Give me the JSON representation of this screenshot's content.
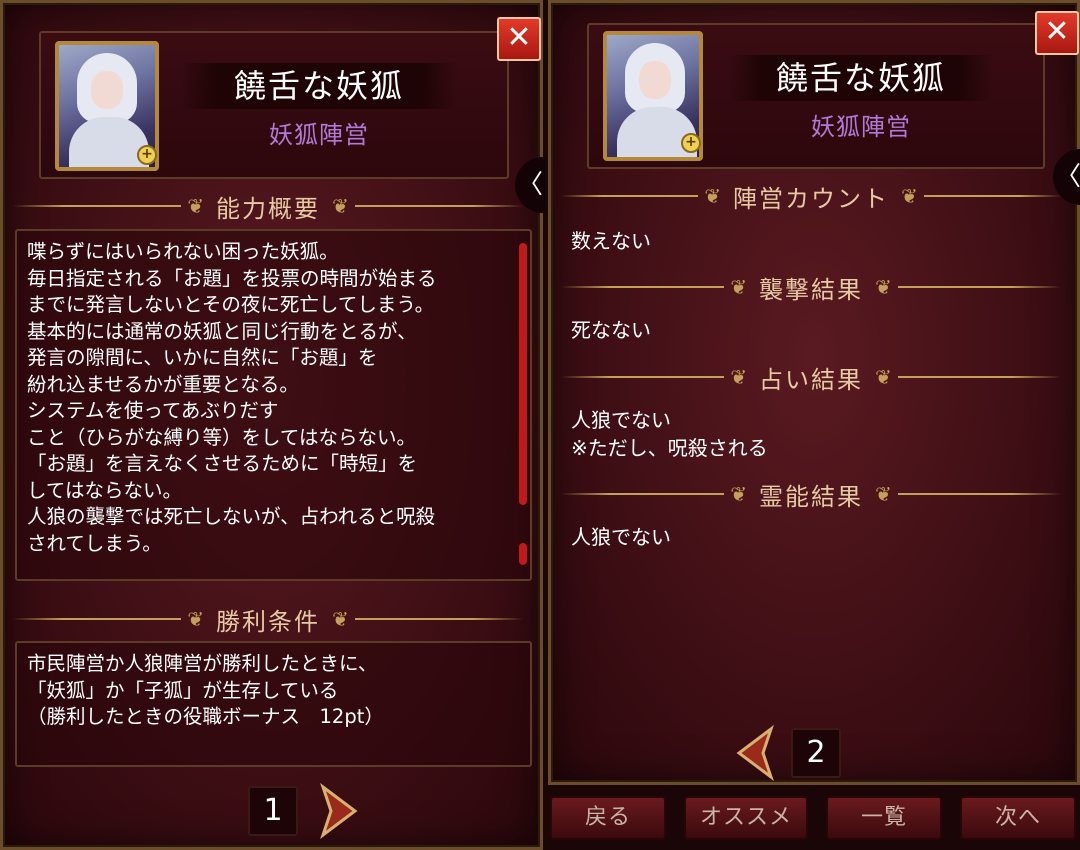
{
  "left_panel": {
    "name": "饒舌な妖狐",
    "faction": "妖狐陣営",
    "close_label": "✕",
    "side_arrow": "〈",
    "ability_header": "能力概要",
    "ability_lines": [
      "喋らずにはいられない困った妖狐。",
      "毎日指定される「お題」を投票の時間が始まる",
      "までに発言しないとその夜に死亡してしまう。",
      "基本的には通常の妖狐と同じ行動をとるが、",
      "発言の隙間に、いかに自然に「お題」を",
      "紛れ込ませるかが重要となる。",
      "システムを使ってあぶりだす",
      "こと（ひらがな縛り等）をしてはならない。",
      "「お題」を言えなくさせるために「時短」を",
      "してはならない。",
      "人狼の襲撃では死亡しないが、占われると呪殺",
      "されてしまう。"
    ],
    "win_header": "勝利条件",
    "win_lines": [
      "市民陣営か人狼陣営が勝利したときに、",
      "「妖狐」か「子狐」が生存している",
      "（勝利したときの役職ボーナス　12pt）"
    ],
    "page": "1"
  },
  "right_panel": {
    "name": "饒舌な妖狐",
    "faction": "妖狐陣営",
    "close_label": "✕",
    "side_arrow": "〈",
    "sections": [
      {
        "header": "陣営カウント",
        "lines": [
          "数えない"
        ]
      },
      {
        "header": "襲撃結果",
        "lines": [
          "死なない"
        ]
      },
      {
        "header": "占い結果",
        "lines": [
          "人狼でない",
          "※ただし、呪殺される"
        ]
      },
      {
        "header": "霊能結果",
        "lines": [
          "人狼でない"
        ]
      }
    ],
    "page": "2"
  },
  "bottom_bar": {
    "back": "戻る",
    "recommend": "オススメ",
    "list": "一覧",
    "next": "次へ"
  },
  "colors": {
    "panel_bg": "#4a1219",
    "gold": "#c4a05a",
    "faction": "#b07ad8",
    "close": "#d42a1c",
    "scrollbar": "#c21a1a"
  }
}
